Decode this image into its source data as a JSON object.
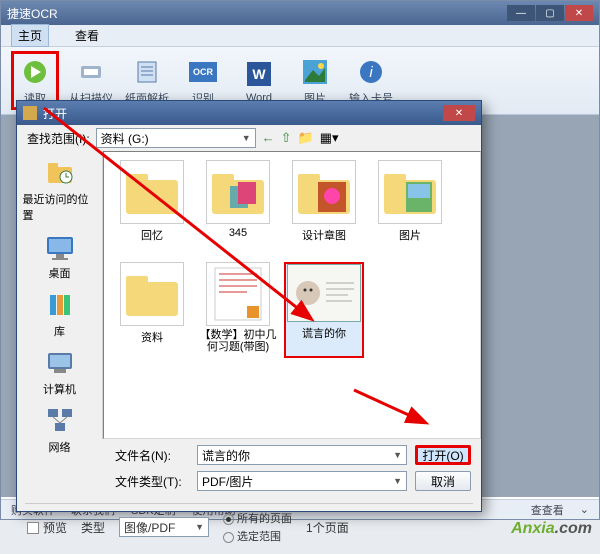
{
  "app": {
    "title": "捷速OCR"
  },
  "menu": {
    "home": "主页",
    "view": "查看"
  },
  "ribbon": {
    "read": "读取",
    "scanner": "从扫描仪",
    "parse": "纸面解析",
    "ocr": "识别",
    "word": "Word",
    "image": "图片",
    "card": "输入卡号",
    "ribbon_ocr_icon": "OCR"
  },
  "status": {
    "buy": "购买软件",
    "contact": "联系我们",
    "sdk": "SDK定制",
    "help": "使用帮助",
    "find": "查查看"
  },
  "dialog": {
    "title": "打开",
    "lookin_label": "查找范围(I):",
    "lookin_value": "资料 (G:)",
    "places": {
      "recent": "最近访问的位置",
      "desktop": "桌面",
      "libraries": "库",
      "computer": "计算机",
      "network": "网络"
    },
    "items": [
      {
        "name": "回忆",
        "type": "folder"
      },
      {
        "name": "345",
        "type": "folder-photos"
      },
      {
        "name": "设计章图",
        "type": "folder-art"
      },
      {
        "name": "图片",
        "type": "folder-photo"
      },
      {
        "name": "资料",
        "type": "folder"
      },
      {
        "name": "【数学】初中几何习题(带图)",
        "type": "doc"
      },
      {
        "name": "谎言的你",
        "type": "photo"
      }
    ],
    "filename_label": "文件名(N):",
    "filename_value": "谎言的你",
    "filetype_label": "文件类型(T):",
    "filetype_value": "PDF/图片",
    "open_btn": "打开(O)",
    "cancel_btn": "取消",
    "preview": "预览",
    "category_label": "类型",
    "category_value": "图像/PDF",
    "range_all": "所有的页面",
    "range_select": "选定范围",
    "page_count": "1个页面"
  },
  "watermark": {
    "brand": "Anxia",
    "suffix": ".com"
  },
  "colors": {
    "highlight": "#e60000"
  }
}
